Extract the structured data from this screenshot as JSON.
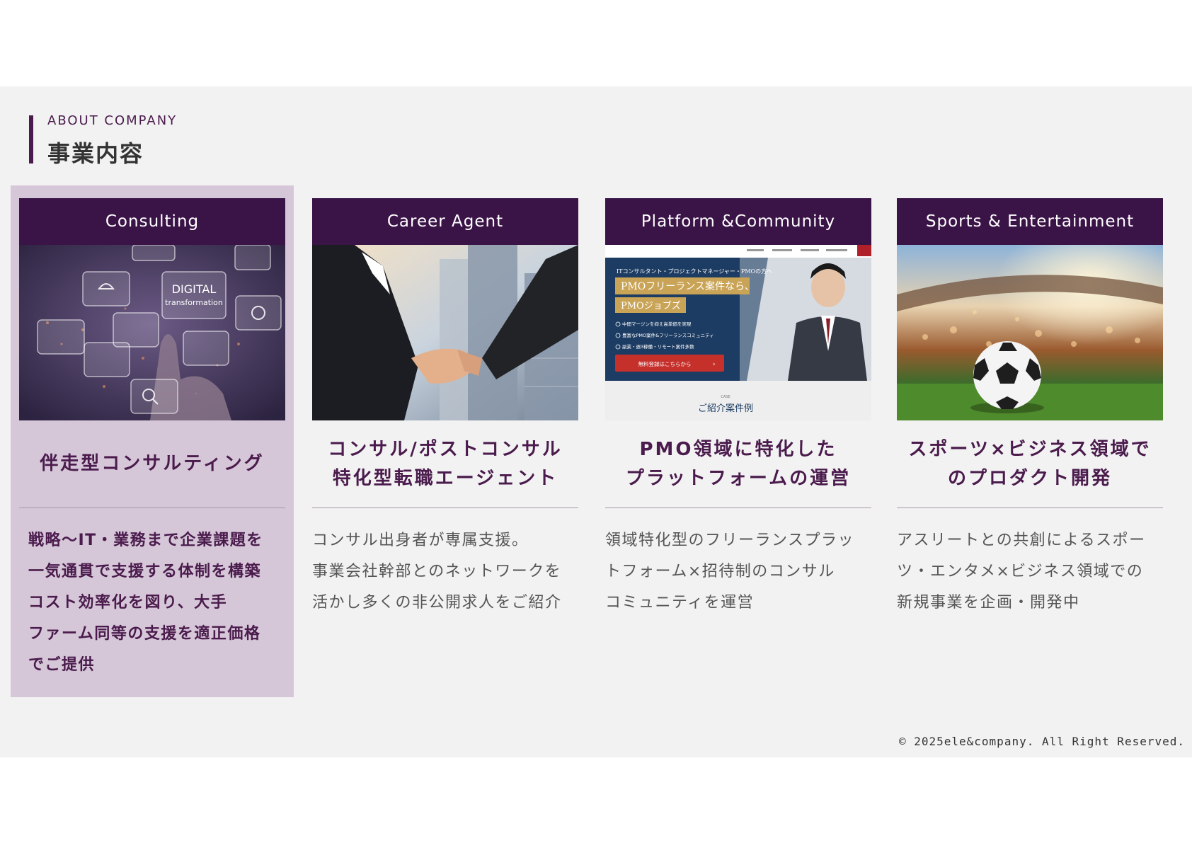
{
  "header": {
    "eyebrow": "ABOUT COMPANY",
    "title": "事業内容"
  },
  "cards": [
    {
      "label": "Consulting",
      "headline": "伴走型コンサルティング",
      "description": "戦略～IT・業務まで企業課題を\n一気通貫で支援する体制を構築\nコスト効率化を図り、大手\nファーム同等の支援を適正価格\nでご提供",
      "image_text": "DIGITAL",
      "image_subtext": "transformation"
    },
    {
      "label": "Career Agent",
      "headline": "コンサル/ポストコンサル\n特化型転職エージェント",
      "description": "コンサル出身者が専属支援。\n事業会社幹部とのネットワークを\n活かし多くの非公開求人をご紹介"
    },
    {
      "label": "Platform &Community",
      "headline": "PMO領域に特化した\nプラットフォームの運営",
      "description": "領域特化型のフリーランスプラッ\nトフォーム×招待制のコンサル\nコミュニティを運営",
      "screenshot": {
        "tagline": "ITコンサルタント・プロジェクトマネージャー・PMOの方へ",
        "banner1": "PMOフリーランス案件なら、",
        "banner2": "PMOジョブズ",
        "points": [
          "中間マージンを抑え高単価を実現",
          "豊富なPMO案件&フリーランスコミュニティ",
          "副業・週3稼働・リモート案件多数"
        ],
        "cta": "無料登録はこちらから",
        "case_label": "CASE",
        "case_title": "ご紹介案件例"
      }
    },
    {
      "label": "Sports & Entertainment",
      "headline": "スポーツ×ビジネス領域で\nのプロダクト開発",
      "description": "アスリートとの共創によるスポー\nツ・エンタメ×ビジネス領域での\n新規事業を企画・開発中"
    }
  ],
  "footer": {
    "copyright": "© 2025ele&company. All Right Reserved."
  },
  "colors": {
    "brand": "#3a1347",
    "highlight": "#d6c7d8",
    "band": "#f2f2f2"
  }
}
